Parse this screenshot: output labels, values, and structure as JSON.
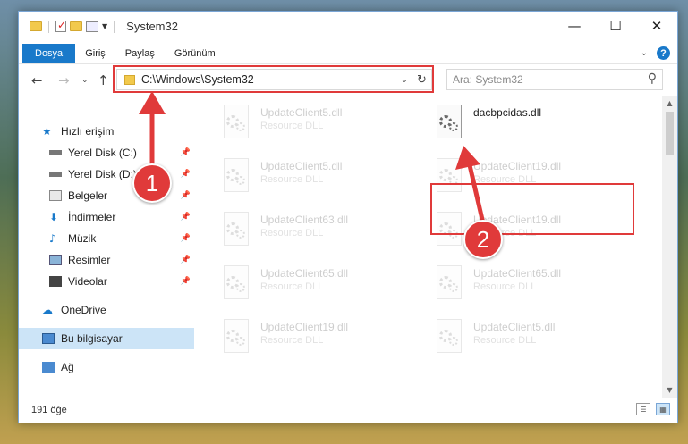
{
  "window": {
    "title": "System32"
  },
  "window_controls": {
    "minimize": "—",
    "maximize": "☐",
    "close": "✕"
  },
  "ribbon": {
    "tabs": [
      {
        "label": "Dosya",
        "active": true
      },
      {
        "label": "Giriş",
        "active": false
      },
      {
        "label": "Paylaş",
        "active": false
      },
      {
        "label": "Görünüm",
        "active": false
      }
    ],
    "help": "?"
  },
  "address": {
    "path": "C:\\Windows\\System32"
  },
  "search": {
    "placeholder": "Ara: System32"
  },
  "navigation": {
    "items": [
      {
        "label": "Hızlı erişim",
        "icon": "star-icon",
        "pinned": false,
        "selected": false
      },
      {
        "label": "Yerel Disk (C:)",
        "icon": "drive-icon",
        "pinned": true,
        "selected": false
      },
      {
        "label": "Yerel Disk (D:)",
        "icon": "drive-icon",
        "pinned": true,
        "selected": false
      },
      {
        "label": "Belgeler",
        "icon": "documents-icon",
        "pinned": true,
        "selected": false
      },
      {
        "label": "İndirmeler",
        "icon": "download-icon",
        "pinned": true,
        "selected": false
      },
      {
        "label": "Müzik",
        "icon": "music-icon",
        "pinned": true,
        "selected": false
      },
      {
        "label": "Resimler",
        "icon": "pictures-icon",
        "pinned": true,
        "selected": false
      },
      {
        "label": "Videolar",
        "icon": "videos-icon",
        "pinned": true,
        "selected": false
      },
      {
        "label": "OneDrive",
        "icon": "cloud-icon",
        "pinned": false,
        "selected": false
      },
      {
        "label": "Bu bilgisayar",
        "icon": "computer-icon",
        "pinned": false,
        "selected": true
      },
      {
        "label": "Ağ",
        "icon": "network-icon",
        "pinned": false,
        "selected": false
      }
    ]
  },
  "files": [
    {
      "name": "UpdateClient5.dll",
      "type": "Resource DLL",
      "highlighted": false
    },
    {
      "name": "dacbpcidas.dll",
      "type": "",
      "highlighted": true
    },
    {
      "name": "UpdateClient5.dll",
      "type": "Resource DLL",
      "highlighted": false
    },
    {
      "name": "UpdateClient19.dll",
      "type": "Resource DLL",
      "highlighted": false
    },
    {
      "name": "UpdateClient63.dll",
      "type": "Resource DLL",
      "highlighted": false
    },
    {
      "name": "UpdateClient19.dll",
      "type": "Resource DLL",
      "highlighted": false
    },
    {
      "name": "UpdateClient65.dll",
      "type": "Resource DLL",
      "highlighted": false
    },
    {
      "name": "UpdateClient65.dll",
      "type": "Resource DLL",
      "highlighted": false
    },
    {
      "name": "UpdateClient19.dll",
      "type": "Resource DLL",
      "highlighted": false
    },
    {
      "name": "UpdateClient5.dll",
      "type": "Resource DLL",
      "highlighted": false
    }
  ],
  "status": {
    "item_count": "191 öğe"
  },
  "annotations": {
    "step1": "1",
    "step2": "2",
    "color": "#e03a3a"
  }
}
